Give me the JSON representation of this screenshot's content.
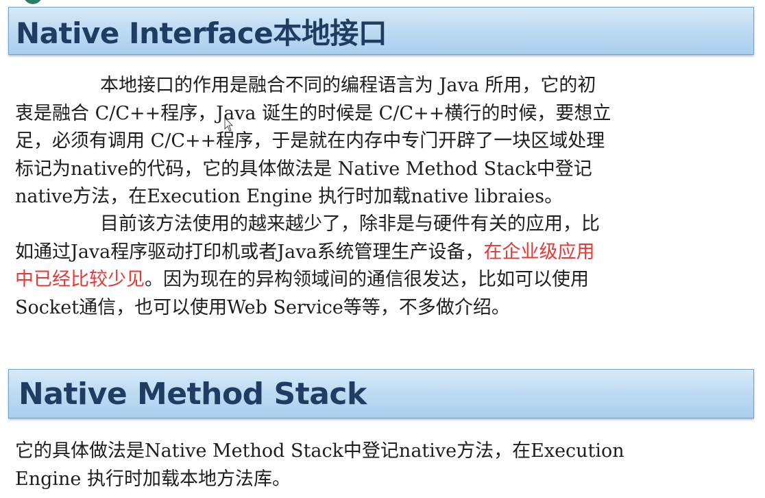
{
  "section1": {
    "title": "Native Interface本地接口",
    "para1": {
      "l1": "本地接口的作用是融合不同的编程语言为 Java 所用，它的初",
      "l2": "衷是融合 C/C++程序，Java 诞生的时候是 C/C++横行的时候，要想立",
      "l3": "足，必须有调用 C/C++程序，于是就在内存中专门开辟了一块区域处理",
      "l4": "标记为native的代码，它的具体做法是 Native Method Stack中登记",
      "l5": "native方法，在Execution Engine 执行时加载native libraies。"
    },
    "para2": {
      "l1": "目前该方法使用的越来越少了，除非是与硬件有关的应用，比",
      "l2_a": "如通过Java程序驱动打印机或者Java系统管理生产设备，",
      "l2_b": "在企业级应用",
      "l3_a": "中已经比较少见",
      "l3_b": "。因为现在的异构领域间的通信很发达，比如可以使用",
      "l4": "Socket通信，也可以使用Web Service等等，不多做介绍。"
    }
  },
  "section2": {
    "title": "Native Method Stack",
    "para": {
      "l1": "它的具体做法是Native Method Stack中登记native方法，在Execution",
      "l2": "Engine 执行时加载本地方法库。"
    }
  },
  "colors": {
    "banner_title": "#1f3d63",
    "highlight": "#e53935",
    "banner_bg": "#bfdcf3"
  },
  "icons": {
    "cursor": "mouse-pointer-icon"
  }
}
